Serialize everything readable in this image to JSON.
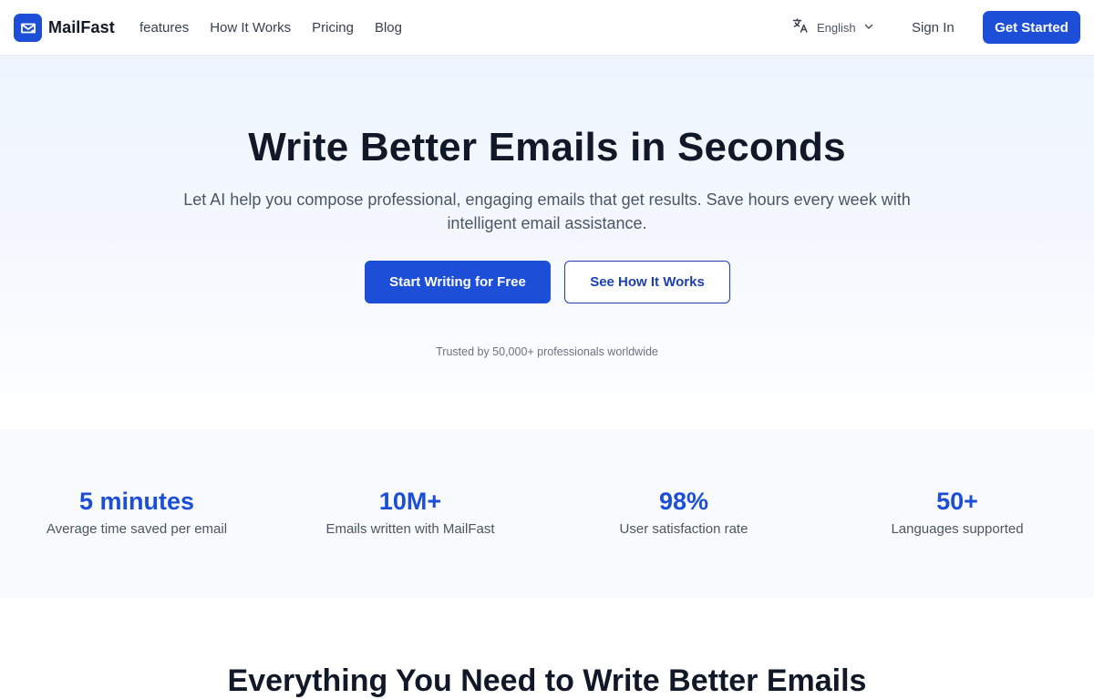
{
  "nav": {
    "brand": "MailFast",
    "links": [
      {
        "label": "features"
      },
      {
        "label": "How It Works"
      },
      {
        "label": "Pricing"
      },
      {
        "label": "Blog"
      }
    ],
    "language": {
      "selected": "English",
      "icon": "translate-icon"
    },
    "sign_in": "Sign In",
    "get_started": "Get Started"
  },
  "hero": {
    "title": "Write Better Emails in Seconds",
    "subtitle": "Let AI help you compose professional, engaging emails that get results. Save hours every week with intelligent email assistance.",
    "primary_cta": "Start Writing for Free",
    "secondary_cta": "See How It Works",
    "trusted": "Trusted by 50,000+ professionals worldwide"
  },
  "stats": [
    {
      "value": "5 minutes",
      "label": "Average time saved per email"
    },
    {
      "value": "10M+",
      "label": "Emails written with MailFast"
    },
    {
      "value": "98%",
      "label": "User satisfaction rate"
    },
    {
      "value": "50+",
      "label": "Languages supported"
    }
  ],
  "features": {
    "heading": "Everything You Need to Write Better Emails"
  },
  "colors": {
    "brand": "#1d4ed8",
    "text": "#111827",
    "muted": "#4b5563"
  }
}
